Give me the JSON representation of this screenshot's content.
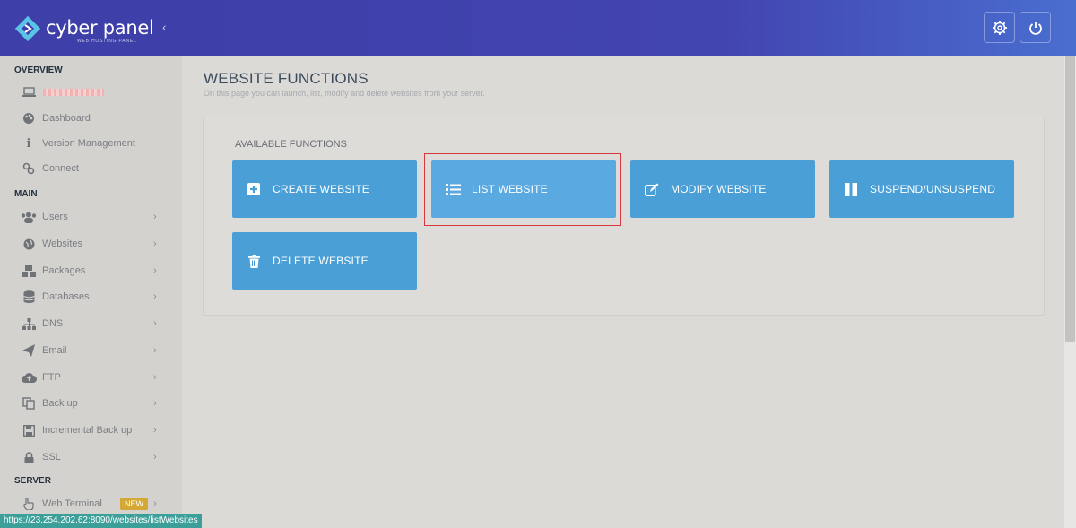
{
  "logo": {
    "title": "cyber panel",
    "subtitle": "WEB HOSTING PANEL"
  },
  "sidebar": {
    "overview_heading": "OVERVIEW",
    "main_heading": "MAIN",
    "server_heading": "SERVER",
    "overview_items": [
      {
        "label": "Dashboard",
        "icon": "palette-icon"
      },
      {
        "label": "Version Management",
        "icon": "info-icon"
      },
      {
        "label": "Connect",
        "icon": "link-icon"
      }
    ],
    "main_items": [
      {
        "label": "Users",
        "icon": "users-icon"
      },
      {
        "label": "Websites",
        "icon": "globe-icon"
      },
      {
        "label": "Packages",
        "icon": "cubes-icon"
      },
      {
        "label": "Databases",
        "icon": "database-icon"
      },
      {
        "label": "DNS",
        "icon": "sitemap-icon"
      },
      {
        "label": "Email",
        "icon": "paper-plane-icon"
      },
      {
        "label": "FTP",
        "icon": "cloud-upload-icon"
      },
      {
        "label": "Back up",
        "icon": "copy-icon"
      },
      {
        "label": "Incremental Back up",
        "icon": "floppy-icon"
      },
      {
        "label": "SSL",
        "icon": "lock-icon"
      }
    ],
    "server_items": [
      {
        "label": "Web Terminal",
        "icon": "hand-pointer-icon",
        "badge": "NEW"
      }
    ]
  },
  "page": {
    "title": "WEBSITE FUNCTIONS",
    "subtitle": "On this page you can launch, list, modify and delete websites from your server.",
    "panel_title": "AVAILABLE FUNCTIONS",
    "functions": [
      {
        "label": "CREATE WEBSITE",
        "icon": "plus-square-icon"
      },
      {
        "label": "LIST WEBSITE",
        "icon": "list-icon"
      },
      {
        "label": "MODIFY WEBSITE",
        "icon": "edit-icon"
      },
      {
        "label": "SUSPEND/UNSUSPEND",
        "icon": "pause-icon"
      },
      {
        "label": "DELETE WEBSITE",
        "icon": "trash-icon"
      }
    ]
  },
  "status_url": "https://23.254.202.62:8090/websites/listWebsites",
  "colors": {
    "topbar": "#3e3fa8",
    "button": "#4a9fd6",
    "highlight": "#d9363e",
    "badge": "#d4a834"
  }
}
